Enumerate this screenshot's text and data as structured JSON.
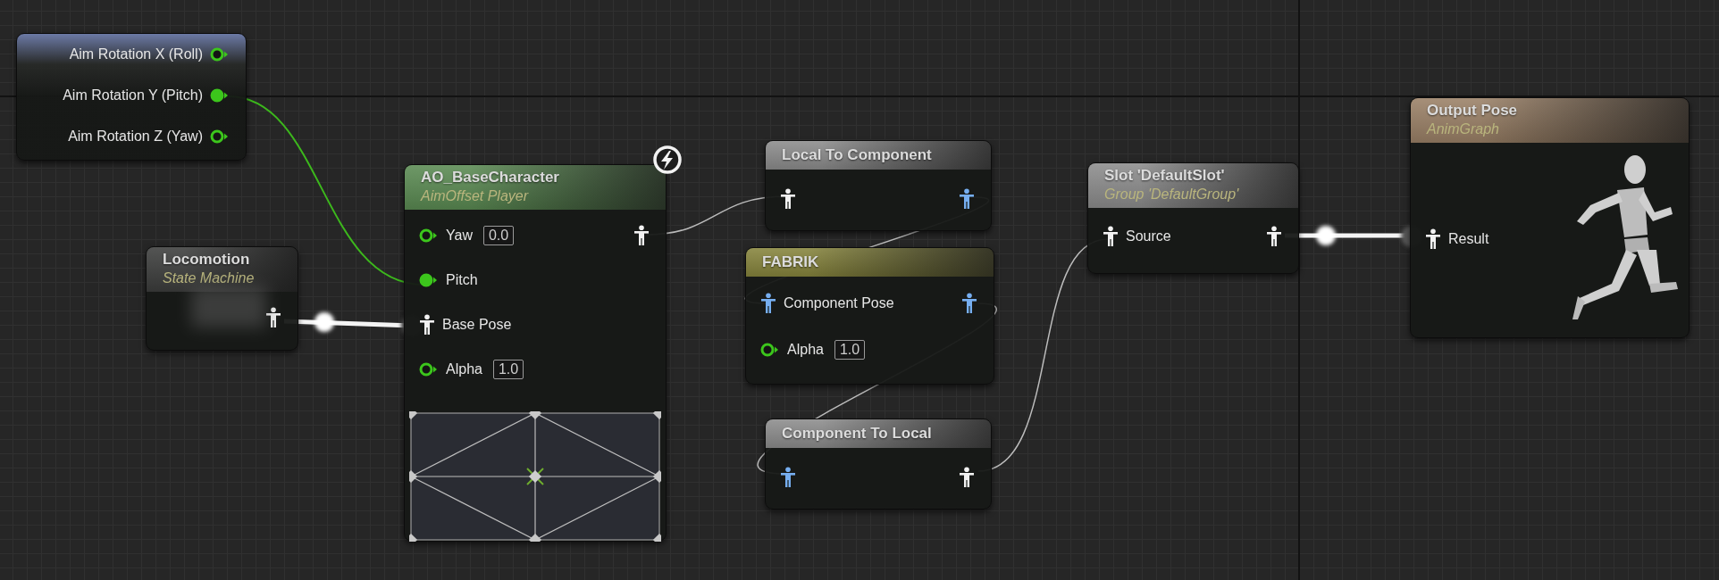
{
  "nodes": [
    {
      "kind": "inputs",
      "color": "#6c7aa6",
      "outputs": [
        {
          "label": "Aim Rotation X (Roll)",
          "kind": "float",
          "connected": false
        },
        {
          "label": "Aim Rotation Y (Pitch)",
          "kind": "float",
          "connected": true
        },
        {
          "label": "Aim Rotation Z (Yaw)",
          "kind": "float",
          "connected": false
        }
      ]
    },
    {
      "kind": "state_machine",
      "title": "Locomotion",
      "subtitle": "State Machine",
      "color": "#3c3d3c",
      "outputs": [
        {
          "kind": "pose"
        }
      ]
    },
    {
      "kind": "blendspace",
      "title": "AO_BaseCharacter",
      "subtitle": "AimOffset Player",
      "color": "#5a8a52",
      "fast_path": true,
      "inputs": [
        {
          "label": "Yaw",
          "kind": "float",
          "connected": false,
          "value": "0.0"
        },
        {
          "label": "Pitch",
          "kind": "float",
          "connected": true
        },
        {
          "label": "Base Pose",
          "kind": "pose"
        },
        {
          "label": "Alpha",
          "kind": "float",
          "connected": false,
          "value": "1.0"
        }
      ],
      "outputs": [
        {
          "kind": "pose"
        }
      ]
    },
    {
      "kind": "plain",
      "title": "Local To Component",
      "color": "#8c8c8c",
      "inputs": [
        {
          "kind": "pose"
        }
      ],
      "outputs": [
        {
          "kind": "component_pose"
        }
      ]
    },
    {
      "kind": "plain",
      "title": "FABRIK",
      "color": "#86843c",
      "inputs": [
        {
          "label": "Component Pose",
          "kind": "component_pose"
        },
        {
          "label": "Alpha",
          "kind": "float",
          "connected": false,
          "value": "1.0"
        }
      ],
      "outputs": [
        {
          "kind": "component_pose"
        }
      ]
    },
    {
      "kind": "plain",
      "title": "Component To Local",
      "color": "#8c8c8c",
      "inputs": [
        {
          "kind": "component_pose"
        }
      ],
      "outputs": [
        {
          "kind": "pose"
        }
      ]
    },
    {
      "kind": "plain",
      "title": "Slot 'DefaultSlot'",
      "subtitle": "Group 'DefaultGroup'",
      "color": "#8c8c8c",
      "inputs": [
        {
          "label": "Source",
          "kind": "pose"
        }
      ],
      "outputs": [
        {
          "kind": "pose"
        }
      ]
    },
    {
      "kind": "result",
      "title": "Output Pose",
      "subtitle": "AnimGraph",
      "color": "#9a8066",
      "inputs": [
        {
          "label": "Result",
          "kind": "pose"
        }
      ]
    }
  ]
}
